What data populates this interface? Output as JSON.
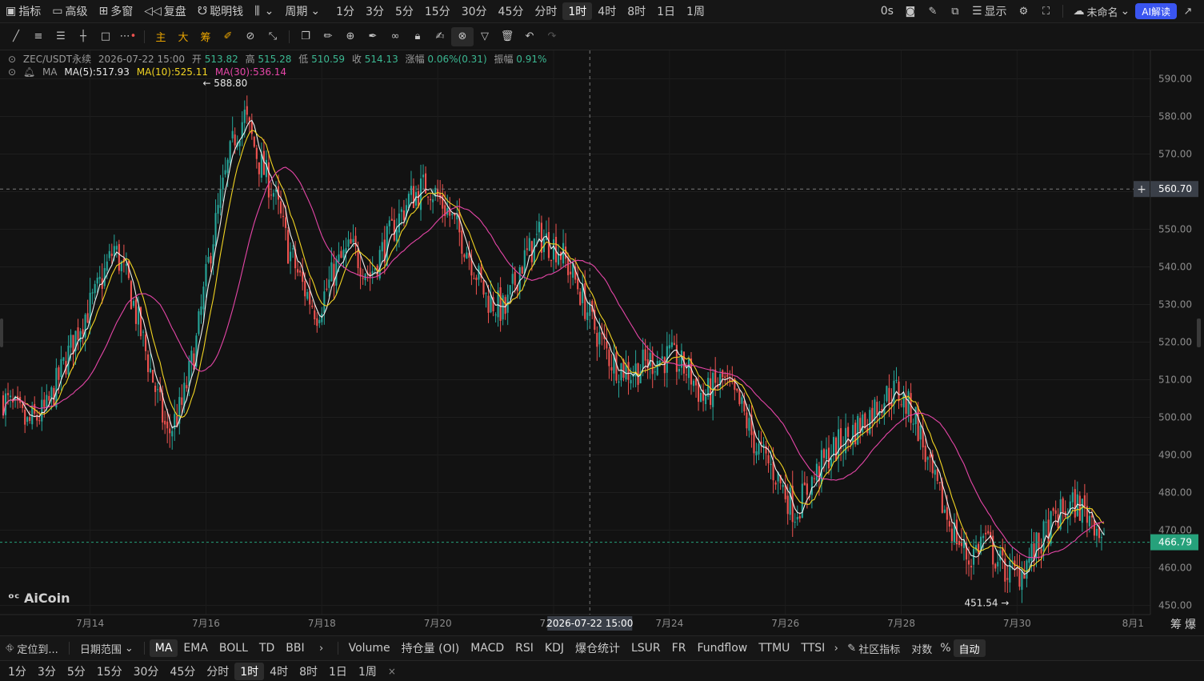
{
  "topbar": {
    "indicators": "指标",
    "advanced": "高级",
    "multi_window": "多窗",
    "replay": "复盘",
    "smart_money": "聪明钱",
    "period": "周期",
    "periods": [
      "1分",
      "3分",
      "5分",
      "15分",
      "30分",
      "45分",
      "分时",
      "1时",
      "4时",
      "8时",
      "1日",
      "1周"
    ],
    "selected_period": "1时",
    "countdown": "0s",
    "display": "显示",
    "unnamed": "未命名",
    "ai": "AI解读"
  },
  "legend": {
    "symbol": "ZEC/USDT永续",
    "time": "2026-07-22 15:00",
    "open_label": "开",
    "open": "513.82",
    "high_label": "高",
    "high": "515.28",
    "low_label": "低",
    "low": "510.59",
    "close_label": "收",
    "close": "514.13",
    "change_label": "涨幅",
    "change": "0.06%(0.31)",
    "amp_label": "振幅",
    "amp": "0.91%",
    "ma_title": "MA",
    "ma5": "MA(5):517.93",
    "ma10": "MA(10):525.11",
    "ma30": "MA(30):536.14"
  },
  "toolbar": {
    "main": "主",
    "large": "大",
    "chip": "筹"
  },
  "logo": "AiCoin",
  "indicator_bar": {
    "locate": "定位到...",
    "date_range": "日期范围",
    "main_inds": [
      "MA",
      "EMA",
      "BOLL",
      "TD",
      "BBI"
    ],
    "selected": "MA",
    "sub_inds": [
      "Volume",
      "持仓量 (OI)",
      "MACD",
      "RSI",
      "KDJ",
      "爆仓统计",
      "LSUR",
      "FR",
      "Fundflow",
      "TTMU",
      "TTSI"
    ],
    "community": "社区指标",
    "log": "对数",
    "percent": "%",
    "auto": "自动",
    "right1": "筹",
    "right2": "爆"
  },
  "period_bar": {
    "items": [
      "1分",
      "3分",
      "5分",
      "15分",
      "30分",
      "45分",
      "分时",
      "1时",
      "4时",
      "8时",
      "1日",
      "1周"
    ],
    "selected": "1时",
    "close": "×"
  },
  "colors": {
    "up": "#26a69a",
    "down": "#ef5350",
    "ma5": "#f0f0f0",
    "ma10": "#f2d422",
    "ma30": "#e646a8",
    "last": "#26a17b"
  },
  "chart_data": {
    "type": "candlestick",
    "interval": "1h",
    "x_labels": [
      "7月14",
      "7月16",
      "7月18",
      "7月20",
      "7月22",
      "7月24",
      "7月26",
      "7月28",
      "7月30",
      "8月1"
    ],
    "ylim": [
      445,
      595
    ],
    "y_ticks": [
      "590.00",
      "580.00",
      "570.00",
      "560.00",
      "550.00",
      "540.00",
      "530.00",
      "520.00",
      "510.00",
      "500.00",
      "490.00",
      "480.00",
      "470.00",
      "460.00",
      "450.00"
    ],
    "crosshair": {
      "price": "560.70",
      "time": "2026-07-22 15:00"
    },
    "last_price": "466.79",
    "max_marker": "588.80",
    "min_marker": "451.54",
    "path": [
      [
        "7/12 12:00",
        505
      ],
      [
        "7/12 22:00",
        498
      ],
      [
        "7/13 06:00",
        502
      ],
      [
        "7/13 12:00",
        512
      ],
      [
        "7/13 20:00",
        525
      ],
      [
        "7/14 02:00",
        532
      ],
      [
        "7/14 10:00",
        545
      ],
      [
        "7/14 16:00",
        535
      ],
      [
        "7/14 22:00",
        520
      ],
      [
        "7/15 04:00",
        505
      ],
      [
        "7/15 08:00",
        495
      ],
      [
        "7/15 14:00",
        503
      ],
      [
        "7/15 20:00",
        520
      ],
      [
        "7/16 02:00",
        545
      ],
      [
        "7/16 06:00",
        558
      ],
      [
        "7/16 12:00",
        575
      ],
      [
        "7/16 16:00",
        580
      ],
      [
        "7/16 22:00",
        568
      ],
      [
        "7/17 04:00",
        560
      ],
      [
        "7/17 10:00",
        545
      ],
      [
        "7/17 16:00",
        535
      ],
      [
        "7/17 22:00",
        528
      ],
      [
        "7/18 06:00",
        540
      ],
      [
        "7/18 12:00",
        545
      ],
      [
        "7/18 20:00",
        538
      ],
      [
        "7/19 04:00",
        548
      ],
      [
        "7/19 12:00",
        558
      ],
      [
        "7/19 20:00",
        562
      ],
      [
        "7/20 04:00",
        555
      ],
      [
        "7/20 12:00",
        545
      ],
      [
        "7/20 20:00",
        532
      ],
      [
        "7/21 04:00",
        528
      ],
      [
        "7/21 10:00",
        540
      ],
      [
        "7/21 18:00",
        548
      ],
      [
        "7/22 02:00",
        545
      ],
      [
        "7/22 10:00",
        535
      ],
      [
        "7/22 16:00",
        525
      ],
      [
        "7/23 00:00",
        515
      ],
      [
        "7/23 08:00",
        512
      ],
      [
        "7/23 16:00",
        515
      ],
      [
        "7/24 00:00",
        516
      ],
      [
        "7/24 08:00",
        512
      ],
      [
        "7/24 14:00",
        505
      ],
      [
        "7/24 22:00",
        510
      ],
      [
        "7/25 06:00",
        502
      ],
      [
        "7/25 12:00",
        492
      ],
      [
        "7/25 20:00",
        485
      ],
      [
        "7/26 04:00",
        475
      ],
      [
        "7/26 10:00",
        482
      ],
      [
        "7/26 18:00",
        490
      ],
      [
        "7/27 02:00",
        495
      ],
      [
        "7/27 10:00",
        500
      ],
      [
        "7/27 16:00",
        505
      ],
      [
        "7/27 22:00",
        507
      ],
      [
        "7/28 06:00",
        500
      ],
      [
        "7/28 12:00",
        485
      ],
      [
        "7/28 20:00",
        472
      ],
      [
        "7/29 04:00",
        462
      ],
      [
        "7/29 10:00",
        468
      ],
      [
        "7/29 18:00",
        460
      ],
      [
        "7/30 00:00",
        458
      ],
      [
        "7/30 08:00",
        465
      ],
      [
        "7/30 16:00",
        473
      ],
      [
        "7/31 00:00",
        477
      ],
      [
        "7/31 08:00",
        473
      ],
      [
        "7/31 12:00",
        467
      ]
    ],
    "series": [
      {
        "name": "MA(5)"
      },
      {
        "name": "MA(10)"
      },
      {
        "name": "MA(30)"
      }
    ]
  }
}
